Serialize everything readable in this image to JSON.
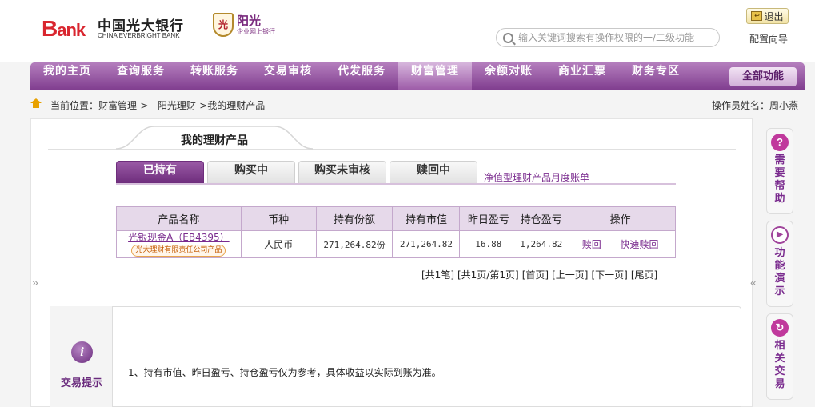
{
  "bank": {
    "logo_b": "B",
    "logo_ank": "ank",
    "name_cn": "中国光大银行",
    "name_en": "CHINA EVERBRIGHT BANK",
    "sunshine_badge": "光",
    "sunshine_name": "阳光",
    "sunshine_sub": "企业网上银行"
  },
  "header": {
    "logout_label": "退出",
    "search_placeholder": "输入关键词搜索有操作权限的一/二级功能",
    "config_guide": "配置向导"
  },
  "nav": {
    "items": [
      "我的主页",
      "查询服务",
      "转账服务",
      "交易审核",
      "代发服务",
      "财富管理",
      "余额对账",
      "商业汇票",
      "财务专区"
    ],
    "active_index": 5,
    "all_functions": "全部功能"
  },
  "breadcrumb": {
    "prefix": "当前位置：",
    "level1": "财富管理->",
    "level2": "阳光理财->我的理财产品",
    "operator": "操作员姓名：周小燕"
  },
  "page": {
    "title_tab": "我的理财产品",
    "subtabs": [
      "已持有",
      "购买中",
      "购买未审核",
      "赎回中"
    ],
    "active_subtab": 0,
    "statement_link": "净值型理财产品月度账单"
  },
  "table": {
    "headers": [
      "产品名称",
      "币种",
      "持有份额",
      "持有市值",
      "昨日盈亏",
      "持仓盈亏",
      "操作"
    ],
    "rows": [
      {
        "product": "光银现金A（EB4395）",
        "issuer": "光大理财有限责任公司产品",
        "currency": "人民币",
        "shares": "271,264.82份",
        "market_value": "271,264.82",
        "yesterday_pl": "16.88",
        "position_pl": "1,264.82",
        "action1": "赎回",
        "action2": "快速赎回"
      }
    ]
  },
  "pager": {
    "total": "[共1笔]",
    "pages": "[共1页/第1页]",
    "first": "[首页]",
    "prev": "[上一页]",
    "next": "[下一页]",
    "last": "[尾页]"
  },
  "tips": {
    "label": "交易提示",
    "line1": "1、持有市值、昨日盈亏、持仓盈亏仅为参考，具体收益以实际到账为准。"
  },
  "side_panel": {
    "help": "需要帮助",
    "demo": "功能演示",
    "related": "相关交易"
  },
  "collapse": {
    "left": "»",
    "right": "«"
  },
  "colors": {
    "brand_purple": "#7f3c8e",
    "brand_red": "#d9262f"
  }
}
